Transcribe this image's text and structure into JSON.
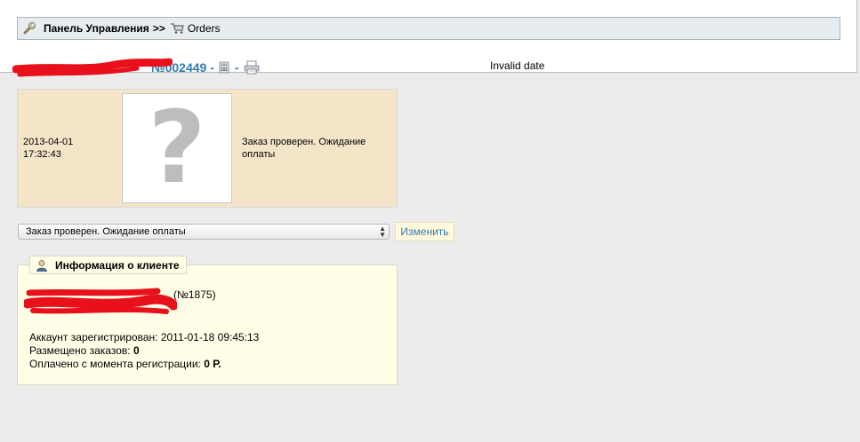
{
  "breadcrumb": {
    "home": "Панель Управления",
    "separator": ">>",
    "current": "Orders"
  },
  "order": {
    "number": "№002449 -",
    "dash": "-",
    "date_text": "Invalid date"
  },
  "status_history": {
    "date": "2013-04-01",
    "time": "17:32:43",
    "image_glyph": "?",
    "status_text": "Заказ проверен. Ожидание оплаты"
  },
  "status_form": {
    "selected": "Заказ проверен. Ожидание оплаты",
    "change_label": "Изменить"
  },
  "client": {
    "section_title": "Информация о клиенте",
    "id_suffix": "(№1875)",
    "registered_label": "Аккаунт зарегистрирован:",
    "registered_value": "2011-01-18 09:45:13",
    "orders_label": "Размещено заказов:",
    "orders_value": "0",
    "paid_label": "Оплачено с момента регистрации:",
    "paid_value": "0 Р."
  },
  "colors": {
    "link": "#2f7db6",
    "status_bg": "#f4e5c9",
    "client_bg": "#ffffe8",
    "redaction": "#e8101a"
  },
  "icons": [
    "wrench-icon",
    "cart-icon",
    "calculator-icon",
    "printer-icon",
    "user-icon",
    "select-arrows-icon"
  ]
}
